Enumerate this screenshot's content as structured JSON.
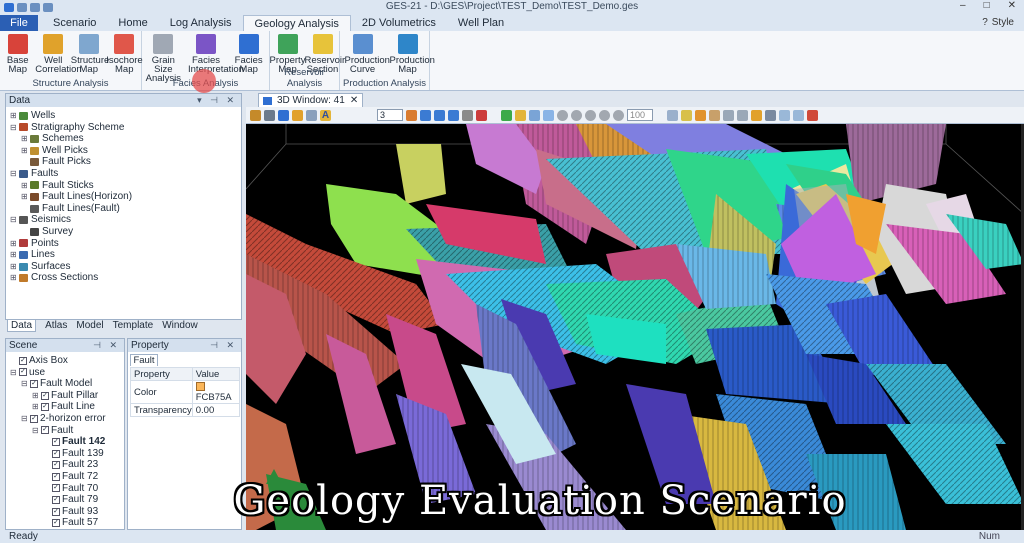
{
  "window": {
    "title": "GES-21 - D:\\GES\\Project\\TEST_Demo\\TEST_Demo.ges",
    "controls": [
      "–",
      "□",
      "✕"
    ]
  },
  "tabs": [
    {
      "label": "File"
    },
    {
      "label": "Scenario"
    },
    {
      "label": "Home"
    },
    {
      "label": "Log Analysis"
    },
    {
      "label": "Geology Analysis"
    },
    {
      "label": "2D Volumetrics"
    },
    {
      "label": "Well Plan"
    }
  ],
  "active_tab": "Geology Analysis",
  "style_label": "Style",
  "ribbon": {
    "groups": [
      {
        "label": "Structure Analysis",
        "buttons": [
          {
            "label1": "Base",
            "label2": "Map",
            "icon": "base-map-icon",
            "color": "#d8433a"
          },
          {
            "label1": "Well",
            "label2": "Correlation",
            "icon": "well-correlation-icon",
            "color": "#e0a22b"
          },
          {
            "label1": "Structure",
            "label2": "Map",
            "icon": "structure-map-icon",
            "color": "#7fa7cf"
          },
          {
            "label1": "Isochore",
            "label2": "Map",
            "icon": "isochore-map-icon",
            "color": "#e0574a"
          }
        ]
      },
      {
        "label": "Facies Analysis",
        "buttons": [
          {
            "label1": "Grain Size",
            "label2": "Analysis",
            "icon": "grain-size-icon",
            "color": "#a0a8b4"
          },
          {
            "label1": "Facies",
            "label2": "Interpretation",
            "icon": "facies-interpretation-icon",
            "color": "#7b55c6"
          },
          {
            "label1": "Facies",
            "label2": "Map",
            "icon": "facies-map-icon",
            "color": "#2f6fd2"
          }
        ]
      },
      {
        "label": "Reservoir Analysis",
        "buttons": [
          {
            "label1": "Property",
            "label2": "Map",
            "icon": "property-map-icon",
            "color": "#3fa35a"
          },
          {
            "label1": "Reservoir",
            "label2": "Section",
            "icon": "reservoir-section-icon",
            "color": "#e7c33a"
          }
        ]
      },
      {
        "label": "Production Analysis",
        "buttons": [
          {
            "label1": "Production",
            "label2": "Curve",
            "icon": "production-curve-icon",
            "color": "#5a8fd0"
          },
          {
            "label1": "Production",
            "label2": "Map",
            "icon": "production-map-icon",
            "color": "#2e86c9"
          }
        ]
      }
    ]
  },
  "data_panel": {
    "title": "Data",
    "tree": [
      {
        "label": "Wells",
        "level": 0,
        "exp": "⊞",
        "icon": "#4a8a3a"
      },
      {
        "label": "Stratigraphy Scheme",
        "level": 0,
        "exp": "⊟",
        "icon": "#b84a2a"
      },
      {
        "label": "Schemes",
        "level": 1,
        "exp": "⊞",
        "icon": "#6a7a3a"
      },
      {
        "label": "Well Picks",
        "level": 1,
        "exp": "⊞",
        "icon": "#c09030"
      },
      {
        "label": "Fault Picks",
        "level": 1,
        "exp": "",
        "icon": "#7a5a3a"
      },
      {
        "label": "Faults",
        "level": 0,
        "exp": "⊟",
        "icon": "#3a5a8a"
      },
      {
        "label": "Fault Sticks",
        "level": 1,
        "exp": "⊞",
        "icon": "#5a7a2a"
      },
      {
        "label": "Fault Lines(Horizon)",
        "level": 1,
        "exp": "⊞",
        "icon": "#7a4a2a"
      },
      {
        "label": "Fault Lines(Fault)",
        "level": 1,
        "exp": "",
        "icon": "#5a5a5a"
      },
      {
        "label": "Seismics",
        "level": 0,
        "exp": "⊟",
        "icon": "#555555"
      },
      {
        "label": "Survey",
        "level": 1,
        "exp": "",
        "icon": "#444444"
      },
      {
        "label": "Points",
        "level": 0,
        "exp": "⊞",
        "icon": "#b03a3a"
      },
      {
        "label": "Lines",
        "level": 0,
        "exp": "⊞",
        "icon": "#3a6ab0"
      },
      {
        "label": "Surfaces",
        "level": 0,
        "exp": "⊞",
        "icon": "#3a8ab0"
      },
      {
        "label": "Cross Sections",
        "level": 0,
        "exp": "⊞",
        "icon": "#c07a2a"
      }
    ],
    "tabs": [
      "Data",
      "Atlas",
      "Model",
      "Template",
      "Window"
    ],
    "active_tab": "Data"
  },
  "scene_panel": {
    "title": "Scene",
    "tree": [
      {
        "label": "Axis Box",
        "level": 0,
        "exp": "",
        "checked": true
      },
      {
        "label": "use",
        "level": 0,
        "exp": "⊟",
        "checked": true
      },
      {
        "label": "Fault Model",
        "level": 1,
        "exp": "⊟",
        "checked": true
      },
      {
        "label": "Fault Pillar",
        "level": 2,
        "exp": "⊞",
        "checked": true
      },
      {
        "label": "Fault Line",
        "level": 2,
        "exp": "⊞",
        "checked": true
      },
      {
        "label": "2-horizon error",
        "level": 1,
        "exp": "⊟",
        "checked": true
      },
      {
        "label": "Fault",
        "level": 2,
        "exp": "⊟",
        "checked": true
      },
      {
        "label": "Fault 142",
        "level": 3,
        "exp": "",
        "checked": true,
        "selected": true
      },
      {
        "label": "Fault 139",
        "level": 3,
        "exp": "",
        "checked": true
      },
      {
        "label": "Fault 23",
        "level": 3,
        "exp": "",
        "checked": true
      },
      {
        "label": "Fault 72",
        "level": 3,
        "exp": "",
        "checked": true
      },
      {
        "label": "Fault 70",
        "level": 3,
        "exp": "",
        "checked": true
      },
      {
        "label": "Fault 79",
        "level": 3,
        "exp": "",
        "checked": true
      },
      {
        "label": "Fault 93",
        "level": 3,
        "exp": "",
        "checked": true
      },
      {
        "label": "Fault 57",
        "level": 3,
        "exp": "",
        "checked": true
      }
    ]
  },
  "property_panel": {
    "title": "Property",
    "tab": "Fault",
    "headers": [
      "Property",
      "Value"
    ],
    "rows": [
      {
        "name": "Color",
        "value": "FCB75A",
        "swatch": "#FCB75A"
      },
      {
        "name": "Transparency",
        "value": "0.00"
      }
    ]
  },
  "view3d": {
    "tab_label": "3D Window: 41",
    "toolbar_value": "3",
    "zoom_value": "100"
  },
  "status": {
    "left": "Ready",
    "right": "Num"
  },
  "caption": "Geology Evaluation Scenario"
}
